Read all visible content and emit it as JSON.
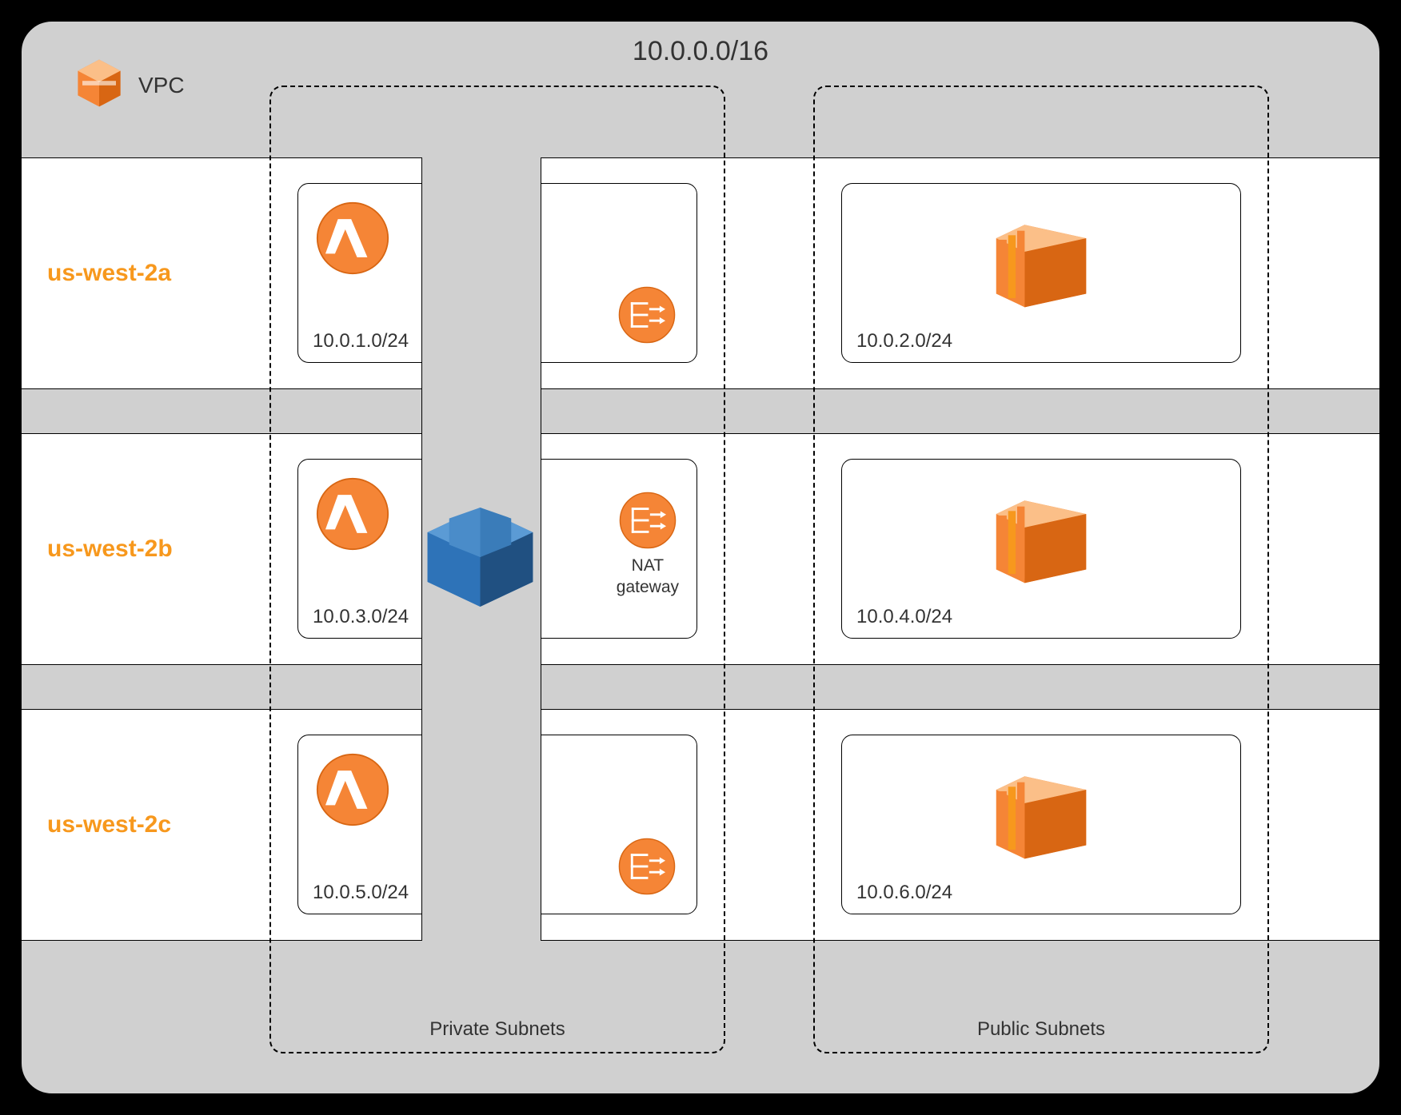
{
  "vpc": {
    "cidr": "10.0.0.0/16",
    "label": "VPC"
  },
  "columns": {
    "private_label": "Private Subnets",
    "public_label": "Public Subnets"
  },
  "nat_label_line1": "NAT",
  "nat_label_line2": "gateway",
  "availability_zones": [
    {
      "name": "us-west-2a",
      "private_cidr": "10.0.1.0/24",
      "public_cidr": "10.0.2.0/24"
    },
    {
      "name": "us-west-2b",
      "private_cidr": "10.0.3.0/24",
      "public_cidr": "10.0.4.0/24"
    },
    {
      "name": "us-west-2c",
      "private_cidr": "10.0.5.0/24",
      "public_cidr": "10.0.6.0/24"
    }
  ],
  "icons": {
    "vpc": "vpc-icon",
    "lambda": "lambda-icon",
    "nat": "nat-gateway-icon",
    "redshift": "redshift-icon",
    "ec2": "ec2-instance-icon"
  },
  "colors": {
    "aws_orange": "#f58536",
    "aws_orange_dark": "#d86613",
    "az_text": "#f7981d",
    "redshift_blue": "#2e73b8",
    "redshift_blue_dark": "#205081"
  }
}
